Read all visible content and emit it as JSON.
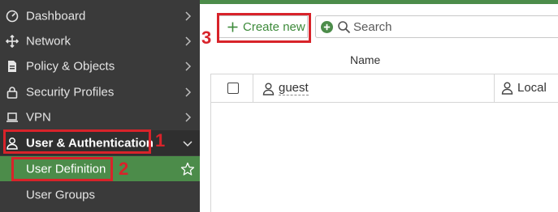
{
  "sidebar": {
    "items": [
      {
        "label": "Dashboard",
        "icon": "dashboard-icon"
      },
      {
        "label": "Network",
        "icon": "network-icon"
      },
      {
        "label": "Policy & Objects",
        "icon": "policy-icon"
      },
      {
        "label": "Security Profiles",
        "icon": "lock-icon"
      },
      {
        "label": "VPN",
        "icon": "laptop-icon"
      },
      {
        "label": "User & Authentication",
        "icon": "user-icon"
      }
    ],
    "subitems": [
      {
        "label": "User Definition"
      },
      {
        "label": "User Groups"
      }
    ]
  },
  "toolbar": {
    "create_label": "Create new",
    "search_placeholder": "Search"
  },
  "table": {
    "columns": [
      "Name"
    ],
    "rows": [
      {
        "name": "guest",
        "type": "Local"
      }
    ]
  },
  "annotations": [
    "1",
    "2",
    "3"
  ],
  "colors": {
    "sidebar_bg": "#3a3a3a",
    "accent_green": "#4c8c4a",
    "annotation_red": "#d8232a"
  }
}
